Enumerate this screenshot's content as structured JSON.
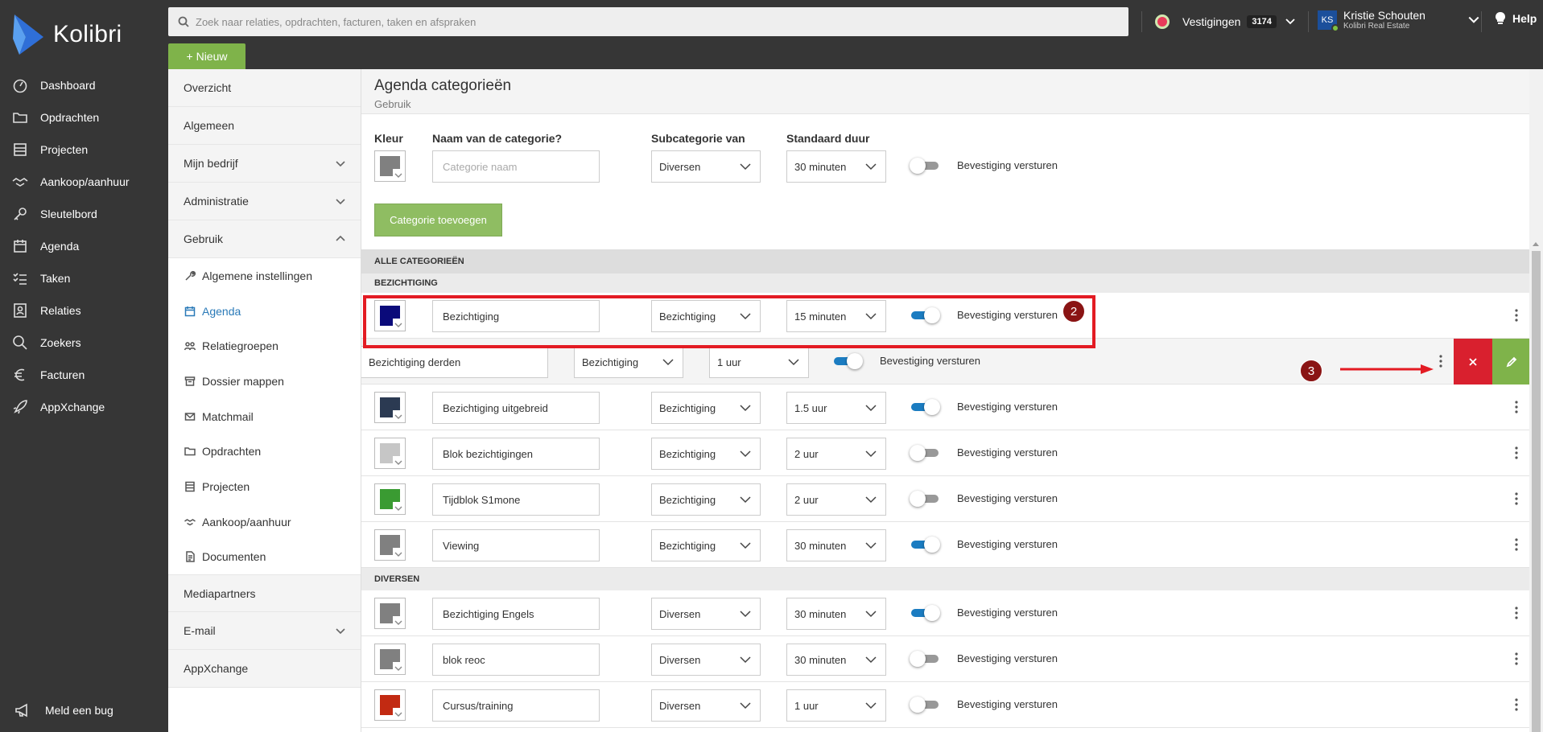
{
  "app": {
    "brand": "Kolibri",
    "nav": [
      {
        "label": "Dashboard",
        "icon": "dashboard-icon"
      },
      {
        "label": "Opdrachten",
        "icon": "folder-icon"
      },
      {
        "label": "Projecten",
        "icon": "projects-icon"
      },
      {
        "label": "Aankoop/aanhuur",
        "icon": "handshake-icon"
      },
      {
        "label": "Sleutelbord",
        "icon": "key-icon"
      },
      {
        "label": "Agenda",
        "icon": "calendar-icon"
      },
      {
        "label": "Taken",
        "icon": "tasks-icon"
      },
      {
        "label": "Relaties",
        "icon": "contacts-icon"
      },
      {
        "label": "Zoekers",
        "icon": "search-icon"
      },
      {
        "label": "Facturen",
        "icon": "euro-icon"
      },
      {
        "label": "AppXchange",
        "icon": "rocket-icon"
      }
    ],
    "bug_label": "Meld een bug"
  },
  "topbar": {
    "search_placeholder": "Zoek naar relaties, opdrachten, facturen, taken en afspraken",
    "new_label": "+ Nieuw",
    "branches_label": "Vestigingen",
    "branches_count": "3174",
    "user_initials": "KS",
    "user_name": "Kristie Schouten",
    "user_company": "Kolibri Real Estate",
    "help_label": "Help"
  },
  "settings_nav": {
    "items": [
      {
        "label": "Overzicht"
      },
      {
        "label": "Algemeen"
      },
      {
        "label": "Mijn bedrijf"
      },
      {
        "label": "Administratie"
      },
      {
        "label": "Gebruik"
      }
    ],
    "sub_items": [
      {
        "label": "Algemene instellingen"
      },
      {
        "label": "Agenda"
      },
      {
        "label": "Relatiegroepen"
      },
      {
        "label": "Dossier mappen"
      },
      {
        "label": "Matchmail"
      },
      {
        "label": "Opdrachten"
      },
      {
        "label": "Projecten"
      },
      {
        "label": "Aankoop/aanhuur"
      },
      {
        "label": "Documenten"
      }
    ],
    "after_items": [
      {
        "label": "Mediapartners"
      },
      {
        "label": "E-mail"
      },
      {
        "label": "AppXchange"
      }
    ]
  },
  "page": {
    "title": "Agenda categorieën",
    "subtitle": "Gebruik"
  },
  "form": {
    "color_label": "Kleur",
    "name_label": "Naam van de categorie?",
    "name_placeholder": "Categorie naam",
    "sub_label": "Subcategorie van",
    "sub_value": "Diversen",
    "duration_label": "Standaard duur",
    "duration_value": "30 minuten",
    "confirm_label": "Bevestiging versturen",
    "add_button": "Categorie toevoegen",
    "colors": {
      "swatch": "#808080"
    }
  },
  "list": {
    "all_header": "ALLE CATEGORIEËN",
    "groups": [
      {
        "header": "BEZICHTIGING",
        "rows": [
          {
            "name": "Bezichtiging",
            "sub": "Bezichtiging",
            "duration": "15 minuten",
            "confirm": true,
            "color": "#0a0a7a",
            "confirm_label": "Bevestiging versturen"
          },
          {
            "name": "Bezichtiging derden",
            "sub": "Bezichtiging",
            "duration": "1 uur",
            "confirm": true,
            "color": "",
            "confirm_label": "Bevestiging versturen"
          },
          {
            "name": "Bezichtiging uitgebreid",
            "sub": "Bezichtiging",
            "duration": "1.5 uur",
            "confirm": true,
            "color": "#2b3a52",
            "confirm_label": "Bevestiging versturen"
          },
          {
            "name": "Blok bezichtigingen",
            "sub": "Bezichtiging",
            "duration": "2 uur",
            "confirm": false,
            "color": "#c6c6c6",
            "confirm_label": "Bevestiging versturen"
          },
          {
            "name": "Tijdblok S1mone",
            "sub": "Bezichtiging",
            "duration": "2 uur",
            "confirm": false,
            "color": "#3a9b32",
            "confirm_label": "Bevestiging versturen"
          },
          {
            "name": "Viewing",
            "sub": "Bezichtiging",
            "duration": "30 minuten",
            "confirm": true,
            "color": "#808080",
            "confirm_label": "Bevestiging versturen"
          }
        ]
      },
      {
        "header": "DIVERSEN",
        "rows": [
          {
            "name": "Bezichtiging Engels",
            "sub": "Diversen",
            "duration": "30 minuten",
            "confirm": true,
            "color": "#808080",
            "confirm_label": "Bevestiging versturen"
          },
          {
            "name": "blok reoc",
            "sub": "Diversen",
            "duration": "30 minuten",
            "confirm": false,
            "color": "#808080",
            "confirm_label": "Bevestiging versturen"
          },
          {
            "name": "Cursus/training",
            "sub": "Diversen",
            "duration": "1 uur",
            "confirm": false,
            "color": "#c22a12",
            "confirm_label": "Bevestiging versturen"
          }
        ]
      }
    ]
  },
  "annotations": {
    "step2": "2",
    "step3": "3",
    "highlight_color": "#e31b23"
  },
  "colors": {
    "accent_green": "#7fb34a",
    "delete_red": "#d9202e",
    "edit_green": "#7fb34a",
    "toggle_on": "#1b7cc1",
    "sidebar_bg": "#363636"
  }
}
